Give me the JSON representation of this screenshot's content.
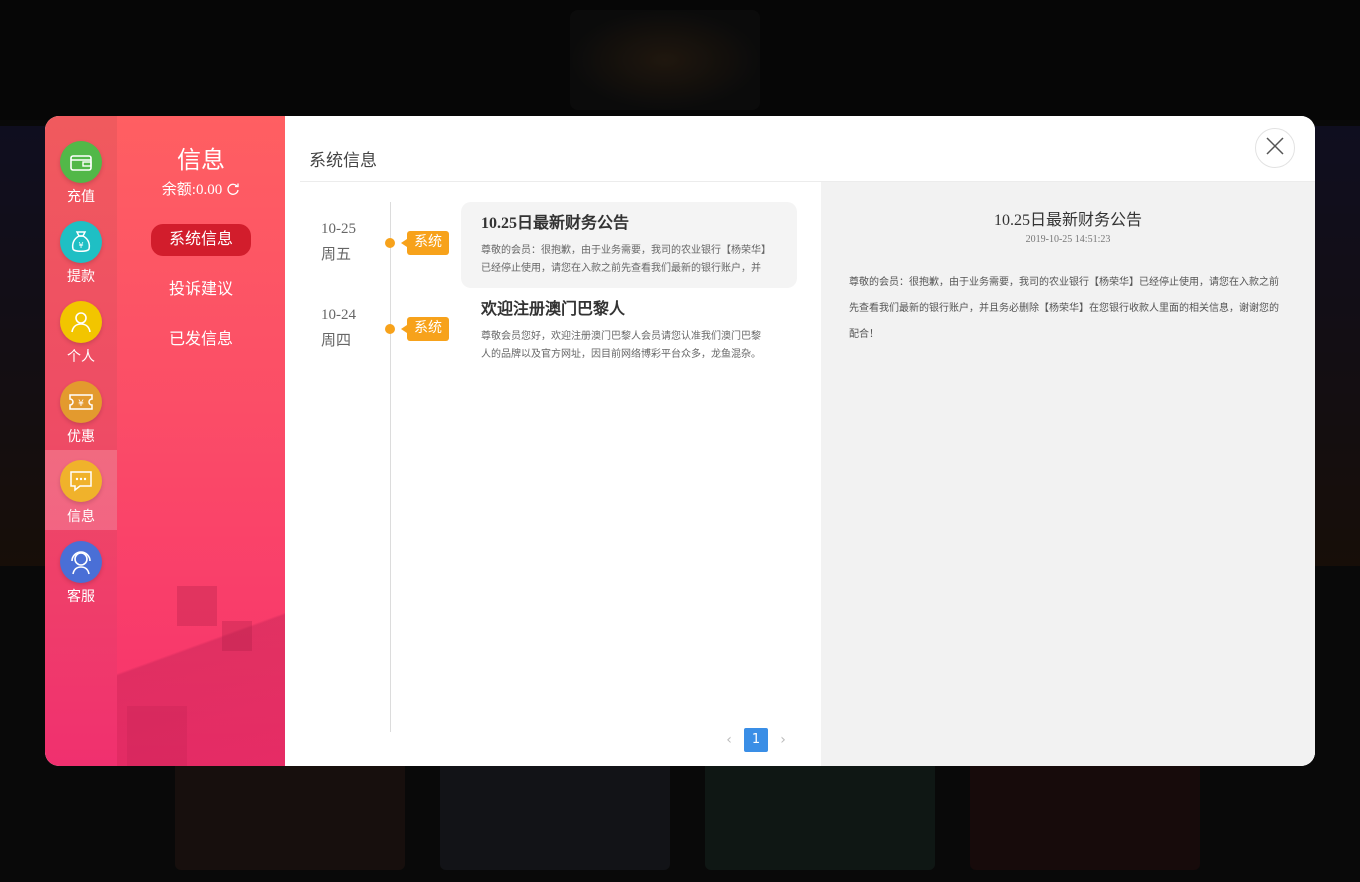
{
  "sidebar": {
    "items": [
      {
        "label": "充值",
        "icon": "wallet-icon",
        "color": "#52b848"
      },
      {
        "label": "提款",
        "icon": "money-bag-icon",
        "color": "#1fbfc4"
      },
      {
        "label": "个人",
        "icon": "user-icon",
        "color": "#f2c500"
      },
      {
        "label": "优惠",
        "icon": "coupon-icon",
        "color": "#e39a2e"
      },
      {
        "label": "信息",
        "icon": "message-icon",
        "color": "#f0b22b",
        "active": true
      },
      {
        "label": "客服",
        "icon": "headset-icon",
        "color": "#4a6fd6"
      }
    ]
  },
  "submenu": {
    "title": "信息",
    "balance_label": "余额:0.00",
    "items": [
      {
        "label": "系统信息",
        "active": true
      },
      {
        "label": "投诉建议"
      },
      {
        "label": "已发信息"
      }
    ]
  },
  "content": {
    "title": "系统信息",
    "messages": [
      {
        "date": "10-25",
        "weekday": "周五",
        "tag": "系统",
        "title": "10.25日最新财务公告",
        "snippet": "尊敬的会员：很抱歉，由于业务需要，我司的农业银行【杨荣华】已经停止使用，请您在入款之前先查看我们最新的银行账户，并且务必删除【杨荣华】在您银行收款人里面的相关信息，谢谢您的配合！",
        "active": true
      },
      {
        "date": "10-24",
        "weekday": "周四",
        "tag": "系统",
        "title": "欢迎注册澳门巴黎人",
        "snippet": "尊敬会员您好，欢迎注册澳门巴黎人会员请您认准我们澳门巴黎人的品牌以及官方网址，因目前网络博彩平台众多，龙鱼混杂。"
      }
    ],
    "pagination": {
      "current": "1",
      "prev": "‹",
      "next": "›"
    }
  },
  "detail": {
    "title": "10.25日最新财务公告",
    "time": "2019-10-25 14:51:23",
    "body": "尊敬的会员：很抱歉，由于业务需要，我司的农业银行【杨荣华】已经停止使用，请您在入款之前先查看我们最新的银行账户，并且务必删除【杨荣华】在您银行收款人里面的相关信息，谢谢您的配合！"
  },
  "colors": {
    "accent_red": "#d21d2c",
    "tag_orange": "#f7a21b",
    "page_blue": "#3a8ee6"
  }
}
